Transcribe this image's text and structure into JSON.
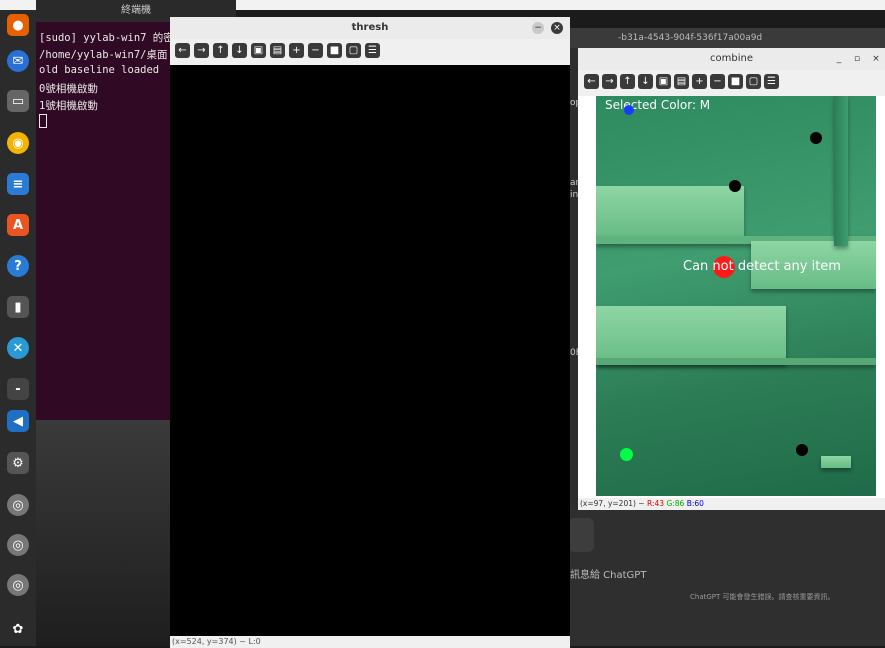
{
  "terminal": {
    "title": "終端機",
    "lines": [
      "[sudo] yylab-win7 的密",
      "/home/yylab-win7/桌面",
      "old baseline loaded",
      "0號相機啟動",
      "1號相機啟動"
    ]
  },
  "thresh": {
    "title": "thresh",
    "status": "(x=524, y=374) ~ L:0"
  },
  "browser": {
    "tab_text": "-b31a-4543-904f-536f17a00a9d",
    "side_texts": [
      "op",
      "ar",
      "in",
      "0E"
    ],
    "chat_placeholder": "訊息給 ChatGPT",
    "disclaimer": "ChatGPT 可能會發生錯誤。請查核重要資訊。"
  },
  "combine": {
    "title": "combine",
    "selected_color": "Selected Color: M",
    "overlay_message": "Can not detect any item",
    "status": {
      "coords": "(x=97, y=201) ~",
      "r": "R:43",
      "g": "G:86",
      "b": "B:60"
    }
  },
  "colors": {
    "terminal_bg": "#300a24",
    "red_marker": "#ff1a1a",
    "green_marker": "#00ff44",
    "blue_marker": "#1a3cff"
  }
}
